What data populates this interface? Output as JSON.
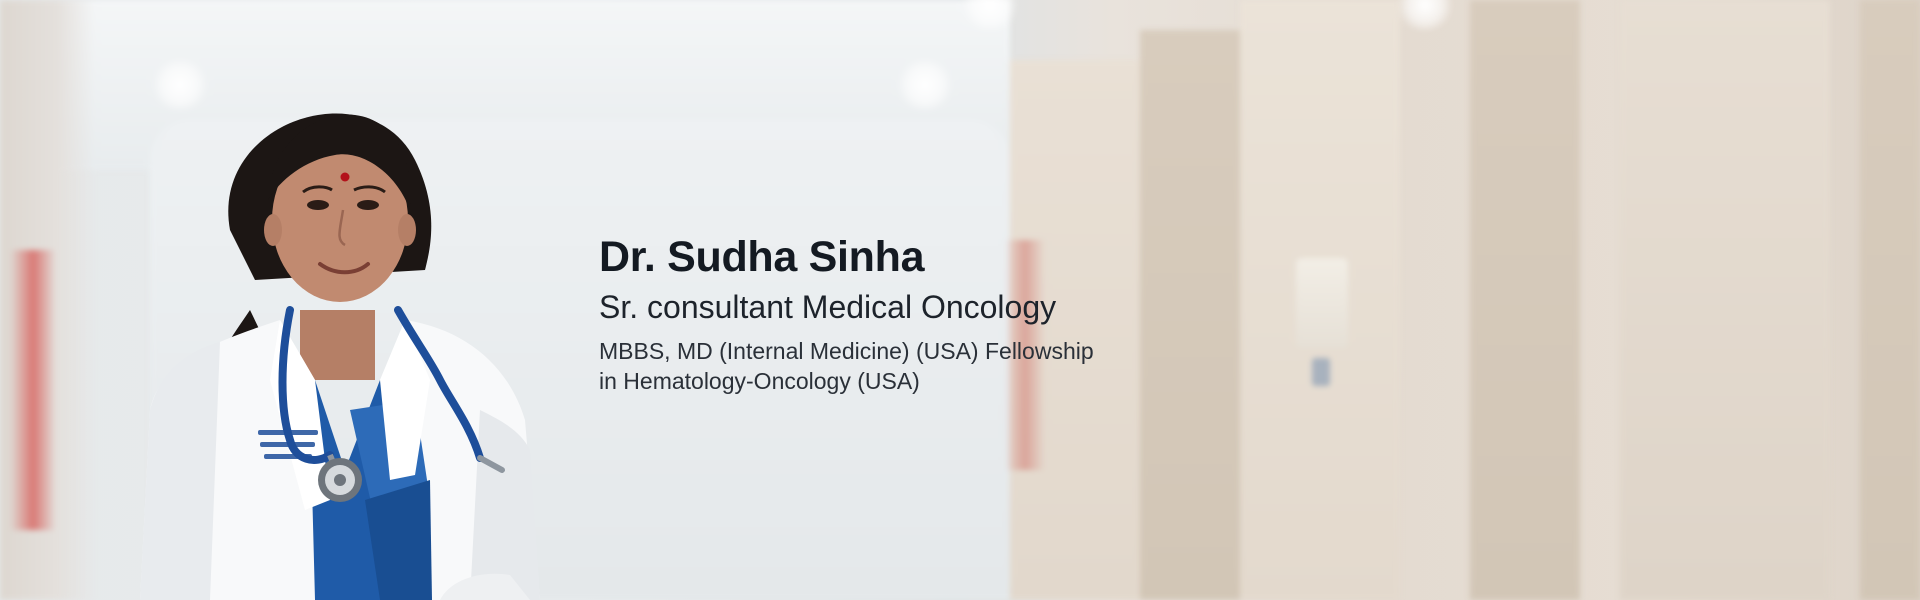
{
  "doctor": {
    "name": "Dr. Sudha Sinha",
    "title": "Sr. consultant Medical Oncology",
    "qualifications_line1": "MBBS, MD (Internal Medicine) (USA) Fellowship",
    "qualifications_line2": "in Hematology-Oncology (USA)"
  },
  "colors": {
    "name_text": "#141a22",
    "coat": "#ffffff",
    "saree": "#1f5ba8",
    "stethoscope": "#1e4e9a"
  },
  "icons": {
    "stethoscope": "stethoscope-icon"
  }
}
